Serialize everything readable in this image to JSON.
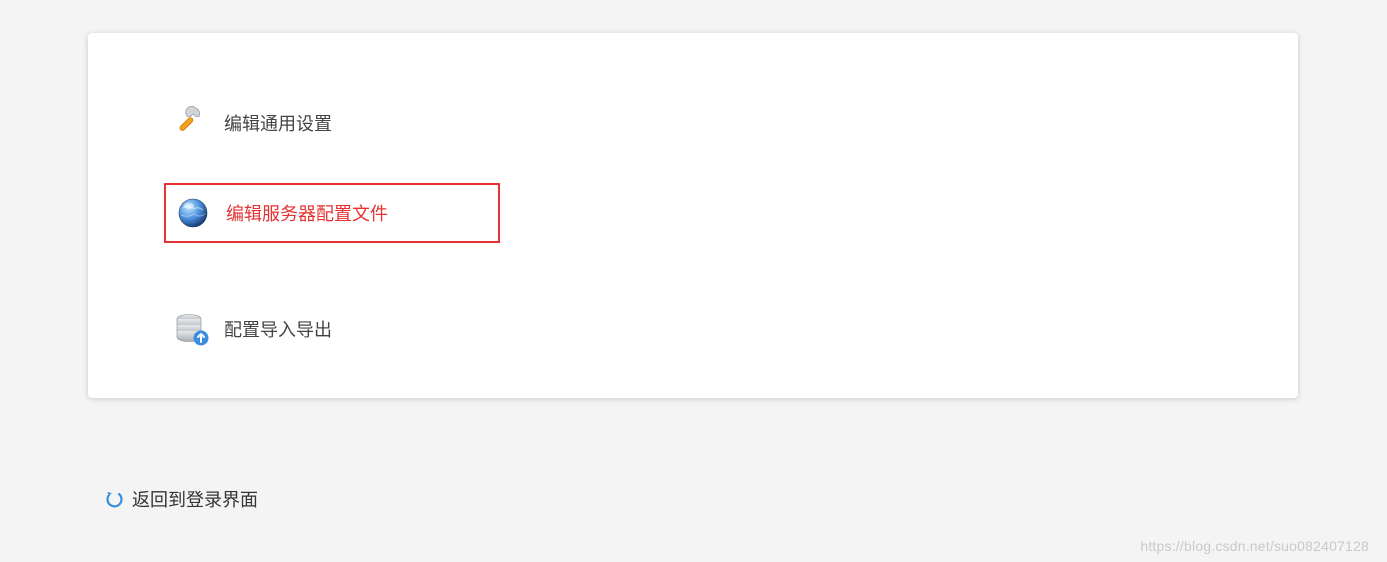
{
  "menu": {
    "items": [
      {
        "label": "编辑通用设置"
      },
      {
        "label": "编辑服务器配置文件"
      },
      {
        "label": "配置导入导出"
      }
    ]
  },
  "backLink": {
    "label": "返回到登录界面"
  },
  "watermark": "https://blog.csdn.net/suo082407128"
}
